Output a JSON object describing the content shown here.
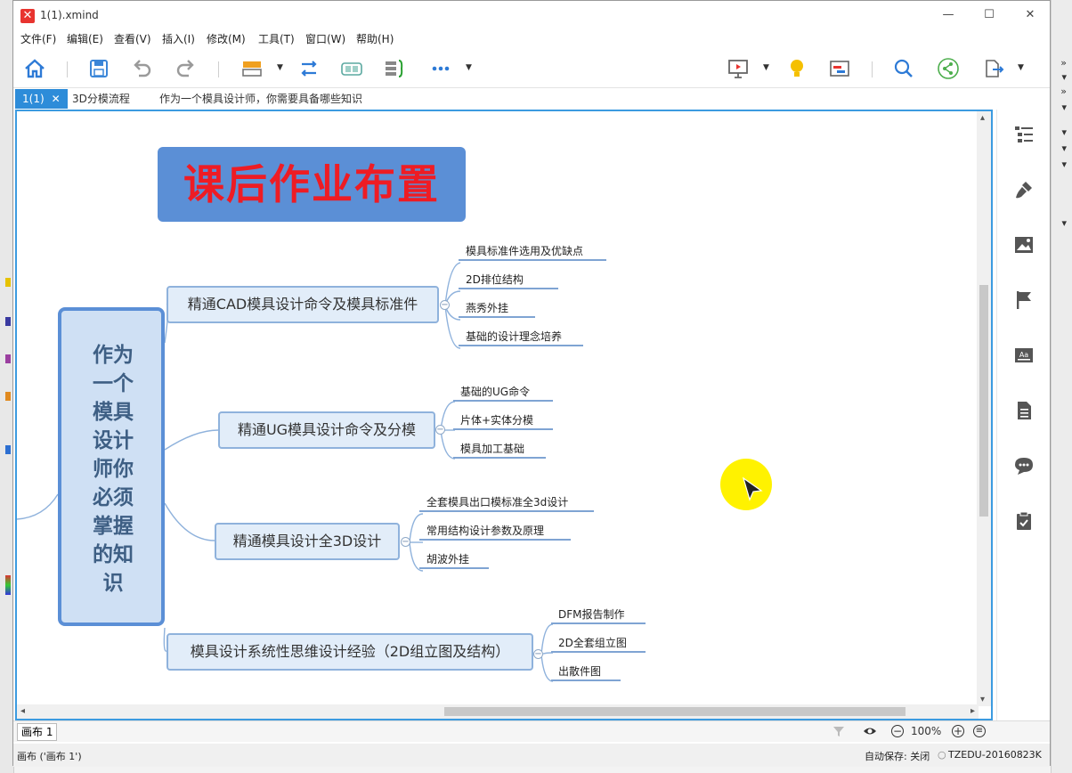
{
  "window": {
    "title": "1(1).xmind",
    "logo": "✕",
    "minimize": "—",
    "maximize": "☐",
    "close": "✕"
  },
  "menu": [
    "文件(F)",
    "编辑(E)",
    "查看(V)",
    "插入(I)",
    "修改(M)",
    "工具(T)",
    "窗口(W)",
    "帮助(H)"
  ],
  "tabs": [
    {
      "label": "1(1)",
      "close": "✕"
    },
    {
      "label": "3D分模流程"
    },
    {
      "label": "作为一个模具设计师，你需要具备哪些知识"
    }
  ],
  "map": {
    "header": "课后作业布置",
    "central": "作为一个模具设计师你必须掌握的知识",
    "branches": [
      {
        "label": "精通CAD模具设计命令及模具标准件",
        "leaves": [
          "模具标准件选用及优缺点",
          "2D排位结构",
          "燕秀外挂",
          "基础的设计理念培养"
        ]
      },
      {
        "label": "精通UG模具设计命令及分模",
        "leaves": [
          "基础的UG命令",
          "片体+实体分模",
          "模具加工基础"
        ]
      },
      {
        "label": "精通模具设计全3D设计",
        "leaves": [
          "全套模具出口模标准全3d设计",
          "常用结构设计参数及原理",
          "胡波外挂"
        ]
      },
      {
        "label": "模具设计系统性思维设计经验（2D组立图及结构）",
        "leaves": [
          "DFM报告制作",
          "2D全套组立图",
          "出散件图"
        ]
      }
    ],
    "collapse_symbol": "−"
  },
  "bottombar": {
    "sheet": "画布 1",
    "zoom": "100%",
    "zoom_out": "−",
    "zoom_in": "+",
    "fit": "≡"
  },
  "status": {
    "left": "画布 ('画布 1')",
    "autosave": "自动保存: 关闭",
    "user": "TZEDU-20160823K"
  },
  "colors": {
    "accent": "#2d8cd9",
    "topic_border": "#5b8fd6",
    "header_text": "#ee1c24"
  }
}
